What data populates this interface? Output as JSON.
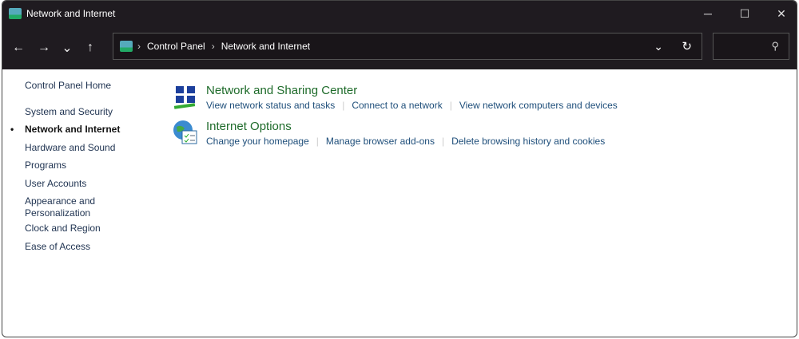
{
  "window": {
    "title": "Network and Internet",
    "minimize": "─",
    "maximize": "☐",
    "close": "✕"
  },
  "toolbar": {
    "back": "←",
    "forward": "→",
    "recent": "⌄",
    "up": "↑",
    "breadcrumb": [
      "Control Panel",
      "Network and Internet"
    ],
    "dropdown": "⌄",
    "refresh": "↻",
    "search_icon": "⚲"
  },
  "sidebar": {
    "items": [
      {
        "label": "Control Panel Home"
      },
      {
        "label": "System and Security"
      },
      {
        "label": "Network and Internet"
      },
      {
        "label": "Hardware and Sound"
      },
      {
        "label": "Programs"
      },
      {
        "label": "User Accounts"
      },
      {
        "label": "Appearance and Personalization"
      },
      {
        "label": "Clock and Region"
      },
      {
        "label": "Ease of Access"
      }
    ]
  },
  "categories": [
    {
      "title": "Network and Sharing Center",
      "links": [
        "View network status and tasks",
        "Connect to a network",
        "View network computers and devices"
      ]
    },
    {
      "title": "Internet Options",
      "links": [
        "Change your homepage",
        "Manage browser add-ons",
        "Delete browsing history and cookies"
      ]
    }
  ]
}
